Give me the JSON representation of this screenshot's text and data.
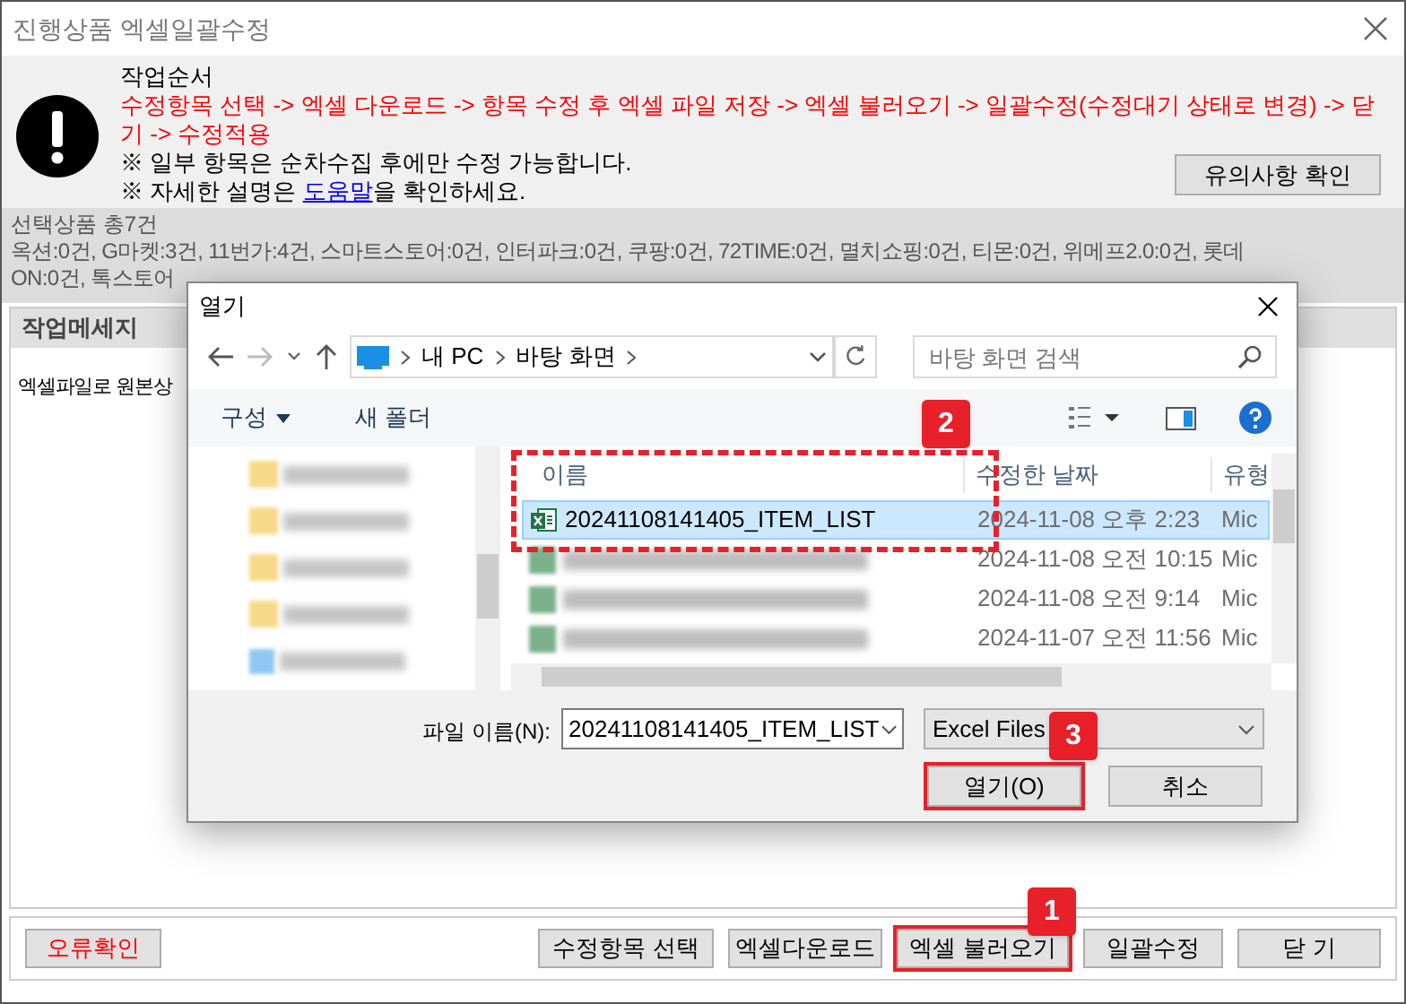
{
  "window": {
    "title": "진행상품 엑셀일괄수정"
  },
  "notice": {
    "heading": "작업순서",
    "steps": "수정항목 선택 -> 엑셀 다운로드 -> 항목 수정 후 엑셀 파일 저장 -> 엑셀 불러오기 -> 일괄수정(수정대기 상태로 변경) -> 닫기 -> 수정적용",
    "note": "※ 일부 항목은 순차수집 후에만 수정 가능합니다.",
    "help_before": "※ 자세한 설명은 ",
    "help_link": "도움말",
    "help_after": "을 확인하세요.",
    "button": "유의사항 확인"
  },
  "selection": {
    "total": "선택상품 총7건",
    "lines": [
      "옥션:0건, G마켓:3건, 11번가:4건, 스마트스토어:0건, 인터파크:0건, 쿠팡:0건, 72TIME:0건, 멸치쇼핑:0건, 티몬:0건, 위메프2.0:0건, 롯데",
      "ON:0건, 톡스토어"
    ]
  },
  "work_log": {
    "header": "작업메세지",
    "message": "엑셀파일로 원본상"
  },
  "buttons": [
    {
      "label": "오류확인",
      "kind": "error"
    },
    {
      "label": "수정항목 선택",
      "kind": "normal"
    },
    {
      "label": "엑셀다운로드",
      "kind": "normal"
    },
    {
      "label": "엑셀 불러오기",
      "kind": "normal",
      "callout": "1"
    },
    {
      "label": "일괄수정",
      "kind": "normal"
    },
    {
      "label": "닫 기",
      "kind": "normal"
    }
  ],
  "dialog": {
    "title": "열기",
    "path": [
      "내 PC",
      "바탕 화면"
    ],
    "search_placeholder": "바탕 화면 검색",
    "toolbar": [
      "구성",
      "새 폴더"
    ],
    "nav_items": [
      {
        "kind": "folder"
      },
      {
        "kind": "folder"
      },
      {
        "kind": "folder"
      },
      {
        "kind": "folder"
      },
      {
        "kind": "drive"
      }
    ],
    "columns": [
      "이름",
      "수정한 날짜",
      "유형"
    ],
    "list_callout": "2",
    "files": [
      {
        "name": "20241108141405_ITEM_LIST",
        "date": "2024-11-08 오후 2:23",
        "type": "Mic",
        "selected": true,
        "blurred": false
      },
      {
        "date": "2024-11-08 오전 10:15",
        "type": "Mic",
        "selected": false,
        "blurred": true
      },
      {
        "date": "2024-11-08 오전 9:14",
        "type": "Mic",
        "selected": false,
        "blurred": true
      },
      {
        "date": "2024-11-07 오전 11:56",
        "type": "Mic",
        "selected": false,
        "blurred": true
      }
    ],
    "filename_label": "파일 이름(N):",
    "filename": "20241108141405_ITEM_LIST",
    "filetype": "Excel Files",
    "open": "열기(O)",
    "open_callout": "3",
    "cancel": "취소"
  }
}
